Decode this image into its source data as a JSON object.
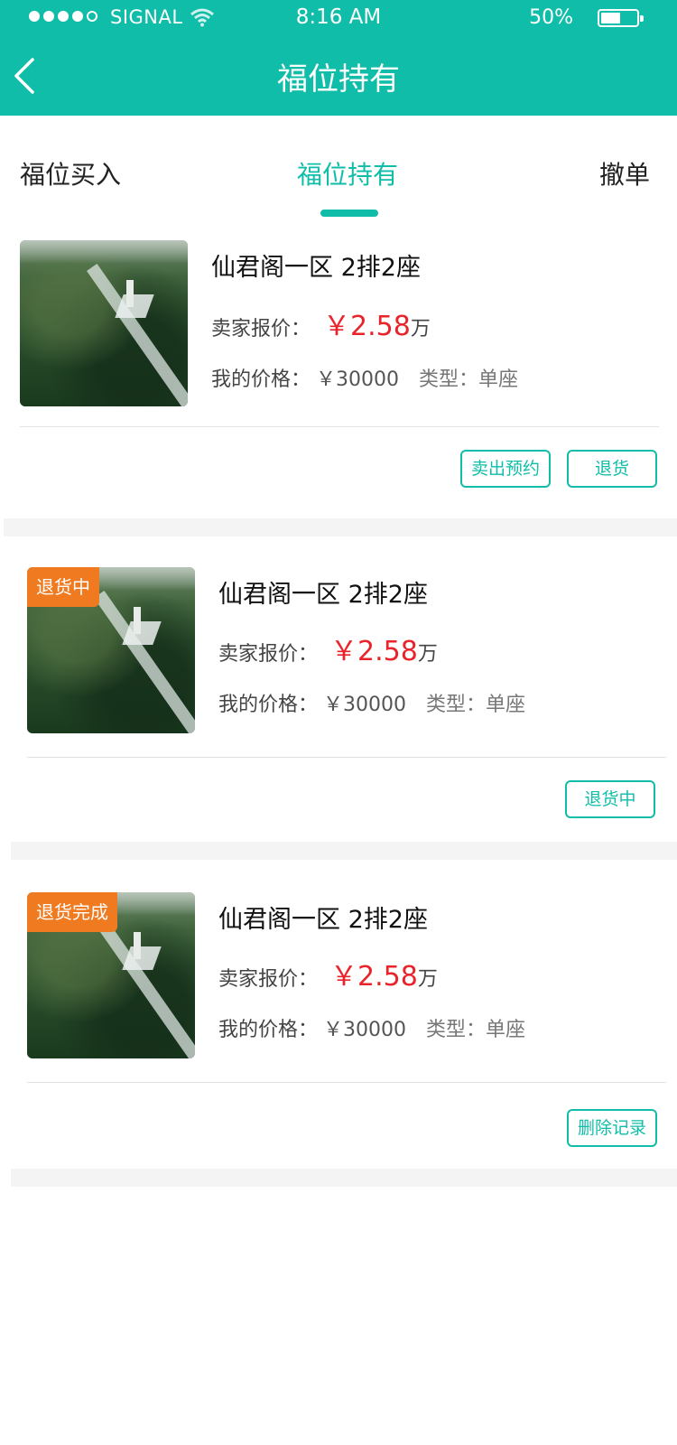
{
  "status_bar": {
    "carrier": "SIGNAL",
    "time": "8:16 AM",
    "battery_pct": "50%",
    "battery_level": 0.5
  },
  "nav": {
    "title": "福位持有",
    "back_icon": "chevron-left-icon"
  },
  "tabs": [
    {
      "label": "福位买入",
      "active": false
    },
    {
      "label": "福位持有",
      "active": true
    },
    {
      "label": "撤单",
      "active": false
    }
  ],
  "colors": {
    "accent": "#10bda8",
    "price_red": "#e8242a",
    "badge_orange": "#f07a20"
  },
  "items": [
    {
      "title": "仙君阁一区  2排2座",
      "seller_label": "卖家报价：",
      "seller_price": "￥2.58",
      "seller_unit": "万",
      "my_price_label": "我的价格：",
      "my_price": "￥30000",
      "type_label": "类型：",
      "type_value": "单座",
      "badge": "",
      "actions": [
        "卖出预约",
        "退货"
      ]
    },
    {
      "title": "仙君阁一区  2排2座",
      "seller_label": "卖家报价：",
      "seller_price": "￥2.58",
      "seller_unit": "万",
      "my_price_label": "我的价格：",
      "my_price": "￥30000",
      "type_label": "类型：",
      "type_value": "单座",
      "badge": "退货中",
      "actions": [
        "退货中"
      ]
    },
    {
      "title": "仙君阁一区  2排2座",
      "seller_label": "卖家报价：",
      "seller_price": "￥2.58",
      "seller_unit": "万",
      "my_price_label": "我的价格：",
      "my_price": "￥30000",
      "type_label": "类型：",
      "type_value": "单座",
      "badge": "退货完成",
      "actions": [
        "删除记录"
      ]
    }
  ]
}
